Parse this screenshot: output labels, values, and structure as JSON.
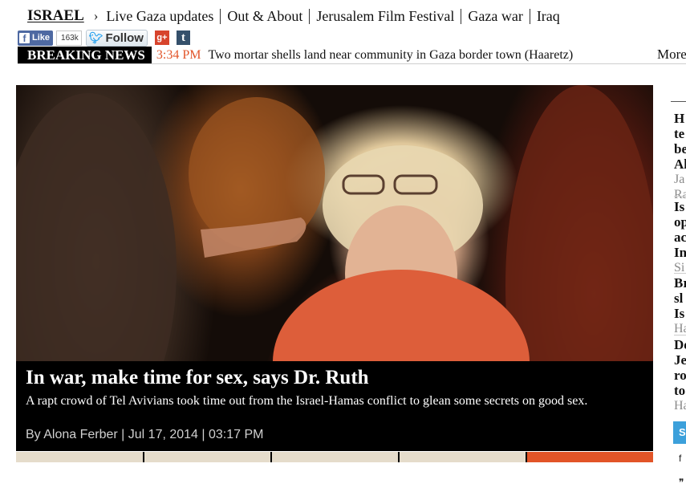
{
  "nav": {
    "section": "ISRAEL",
    "items": [
      "Live Gaza updates",
      "Out & About",
      "Jerusalem Film Festival",
      "Gaza war",
      "Iraq"
    ]
  },
  "social": {
    "facebook_label": "Like",
    "facebook_count": "163k",
    "twitter_label": "Follow",
    "googleplus_label": "g+",
    "tumblr_label": "t"
  },
  "breaking": {
    "label": "BREAKING NEWS",
    "time": "3:34 PM",
    "text": "Two mortar shells land near community in Gaza border town (Haaretz)",
    "more": "More"
  },
  "hero": {
    "headline": "In war, make time for sex, says Dr. Ruth",
    "dek": "A rapt crowd of Tel Avivians took time out from the Israel-Hamas conflict to glean some secrets on good sex.",
    "byline": "By Alona Ferber | Jul 17, 2014 | 03:17 PM",
    "slider_tabs": 5,
    "active_tab": 4
  },
  "rail": {
    "items": [
      {
        "title": [
          "H",
          "te",
          "be",
          "Al"
        ],
        "author": [
          "Ja",
          "Ra"
        ]
      },
      {
        "title": [
          "Is",
          "op",
          "ac",
          "In"
        ],
        "author": [
          "Si"
        ]
      },
      {
        "title": [
          "Br",
          "sl",
          "Is"
        ],
        "author": [
          "Ha"
        ]
      },
      {
        "title": [
          "De",
          "Je",
          "ro",
          "to"
        ],
        "author": [
          "Ha"
        ]
      }
    ],
    "box_label": "S",
    "glyphs": [
      "f",
      "❞"
    ]
  },
  "colors": {
    "accent": "#e2552a",
    "breaking_bg": "#000000",
    "facebook": "#4e69a2",
    "twitter": "#2aa3ef",
    "googleplus": "#d7442d",
    "tumblr": "#35506b",
    "rail_box": "#3ca0db"
  }
}
